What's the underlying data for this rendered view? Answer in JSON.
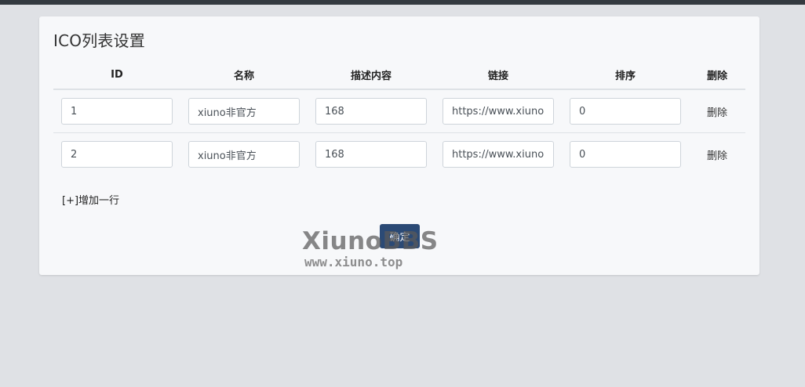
{
  "card": {
    "title": "ICO列表设置"
  },
  "table": {
    "headers": {
      "id": "ID",
      "name": "名称",
      "desc": "描述内容",
      "link": "链接",
      "sort": "排序",
      "delete": "删除"
    },
    "rows": [
      {
        "id": "1",
        "name": "xiuno非官方",
        "desc": "168",
        "link": "https://www.xiuno.top",
        "sort": "0",
        "delete_label": "删除"
      },
      {
        "id": "2",
        "name": "xiuno非官方",
        "desc": "168",
        "link": "https://www.xiuno.top",
        "sort": "0",
        "delete_label": "删除"
      }
    ]
  },
  "actions": {
    "add_row": "[+]增加一行",
    "submit": "确定"
  },
  "watermark": {
    "line1": "XiunoBBS",
    "line2": "www.xiuno.top"
  },
  "colors": {
    "page_bg": "#dfe1e5",
    "card_bg": "#f7f8fa",
    "primary": "#2b4a75",
    "topbar": "#343a40"
  }
}
